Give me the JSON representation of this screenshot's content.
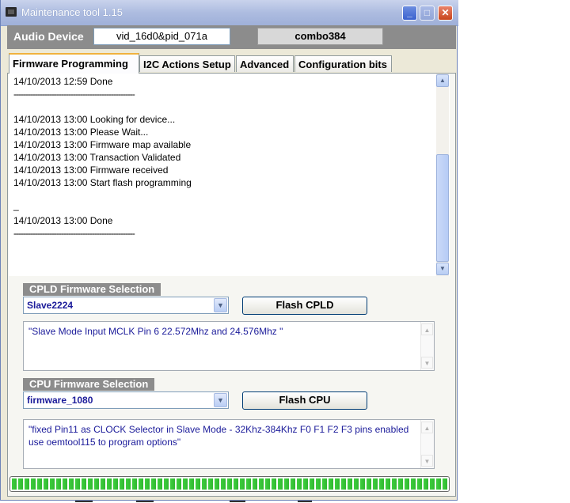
{
  "window": {
    "title": "Maintenance tool 1.15",
    "buttons": {
      "minimize": "_",
      "maximize": "□",
      "close": "✕"
    }
  },
  "device": {
    "label": "Audio Device",
    "id_value": "vid_16d0&pid_071a",
    "combo_value": "combo384"
  },
  "tabs": [
    {
      "label": "Firmware Programming",
      "active": true
    },
    {
      "label": "I2C Actions Setup",
      "active": false
    },
    {
      "label": "Advanced",
      "active": false
    },
    {
      "label": "Configuration bits",
      "active": false
    }
  ],
  "log": {
    "lines": [
      "14/10/2013 12:59 Done",
      "---------------------------------------------------",
      "",
      "14/10/2013 13:00 Looking for device...",
      "14/10/2013 13:00 Please Wait...",
      "14/10/2013 13:00 Firmware map available",
      "14/10/2013 13:00 Transaction Validated",
      "14/10/2013 13:00 Firmware received",
      "14/10/2013 13:00 Start flash programming",
      "",
      "_",
      "14/10/2013 13:00 Done",
      "---------------------------------------------------"
    ]
  },
  "cpld": {
    "section_title": "CPLD Firmware Selection",
    "selected": "Slave2224",
    "button_label": "Flash CPLD",
    "description": "\"Slave Mode Input MCLK Pin 6 22.572Mhz and 24.576Mhz \""
  },
  "cpu": {
    "section_title": "CPU Firmware Selection",
    "selected": "firmware_1080",
    "button_label": "Flash CPU",
    "description": "\"fixed Pin11 as CLOCK Selector in Slave Mode - 32Khz-384Khz F0 F1 F2 F3 pins enabled use oemtool115 to program options\""
  },
  "progress": {
    "fraction": 1.0
  },
  "colors": {
    "accent_tab": "#f0b23e",
    "section_bg": "#8c8c8c",
    "progress": "#3fcf3f",
    "memo_text": "#1b1b9a"
  },
  "icons": {
    "app": "chip-icon",
    "scroll_up": "scroll-up-arrow-icon",
    "scroll_down": "scroll-down-arrow-icon",
    "dropdown": "chevron-down-icon"
  }
}
